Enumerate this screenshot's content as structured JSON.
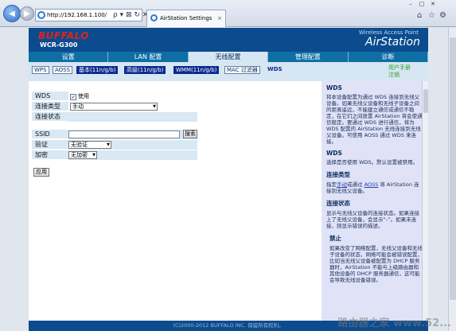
{
  "browser": {
    "url": "http://192.168.1.100/",
    "tab_title": "AirStation Settings",
    "tab_close": "×",
    "back_glyph": "◀",
    "forward_glyph": "▶",
    "address_icons": "ρ ▾ ⊠ ↻ ✕",
    "window_controls": [
      "–",
      "□",
      "✕"
    ],
    "right_icons": [
      "⌂",
      "☆",
      "⚙"
    ]
  },
  "header": {
    "logo": "BUFFALO",
    "model": "WCR-G300",
    "tagline": "Wireless Access Point",
    "brand": "AirStation"
  },
  "nav": {
    "tabs": [
      {
        "label": "设置",
        "active": false
      },
      {
        "label": "LAN 配置",
        "active": false
      },
      {
        "label": "无线配置",
        "active": true
      },
      {
        "label": "管理配置",
        "active": false
      },
      {
        "label": "诊断",
        "active": false
      }
    ]
  },
  "subnav": {
    "items": [
      "WPS",
      "AOSS",
      "基本(11n/g/b)",
      "高级(11n/g/b)",
      "WMM(11n/g/b)",
      "MAC 过滤器",
      "WDS"
    ],
    "manual": "用户手册",
    "logout": "注销"
  },
  "form": {
    "wds_label": "WDS",
    "wds_check": "✓",
    "wds_enable": "使用",
    "conn_type_label": "连接类型",
    "conn_type_value": "手动",
    "conn_status_label": "连接状态",
    "ssid_label": "SSID",
    "search_button": "搜索",
    "auth_label": "验证",
    "auth_value": "无验证",
    "enc_label": "加密",
    "enc_value": "无加密",
    "apply_button": "应用",
    "select_arrow": "▼"
  },
  "help": {
    "sections": [
      {
        "title": "WDS",
        "text": "将本设备配置为通过 WDS 连接到无线父设备。如果无线父设备和无线子设备之间的距离遥远，不能建立通信或通信不稳定，在它们之间放置 AirStation 将会使通信稳定。要通过 WDS 进行通信，将为 WDS 配置的 AirStation 无线连接到无线父设备。可使用 AOSS 通过 WDS 来连接。"
      },
      {
        "title": "WDS",
        "text": "选择是否使用 WDS。默认设置被禁用。"
      },
      {
        "title": "连接类型",
        "text_pre": "指定",
        "link1": "手动",
        "text_mid": "或通过",
        "link2": "AOSS",
        "text_post": "将 AirStation 连接到无线父设备。"
      },
      {
        "title": "连接状态",
        "text": "显示与无线父设备的连接状态。如果连接上了无线父设备，会显示“-”。如果未连接，则显示错误的描述。"
      },
      {
        "title": "禁止",
        "text": "如果改变了网络配置，无线父设备和无线子设备的状态，网络可能会被错误配置，比如当无线父设备被配置为 DHCP 服务器时，AirStation 不能与上级路由器和其他设备的 DHCP 服务器通信，这可能会导致无线设备错误。"
      }
    ]
  },
  "footer": {
    "copyright": "(C)2000-2012 BUFFALO INC. 保留所有权利。"
  },
  "watermark": "路由器之家 www.52..."
}
